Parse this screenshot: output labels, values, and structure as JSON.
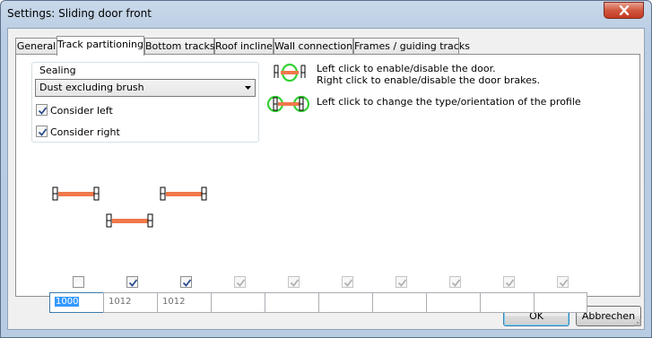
{
  "window": {
    "title": "Settings: Sliding door front"
  },
  "tabs": [
    {
      "label": "General"
    },
    {
      "label": "Track partitioning"
    },
    {
      "label": "Bottom tracks"
    },
    {
      "label": "Roof incline"
    },
    {
      "label": "Wall connection"
    },
    {
      "label": "Frames / guiding tracks"
    }
  ],
  "sealing": {
    "group_label": "Sealing",
    "selected": "Dust excluding brush",
    "consider_left": {
      "label": "Consider left",
      "checked": true
    },
    "consider_right": {
      "label": "Consider right",
      "checked": true
    }
  },
  "legend": {
    "line1": "Left click to enable/disable the door.",
    "line2": "Right click to enable/disable the door brakes.",
    "line3": "Left click to change the type/orientation of the profile"
  },
  "tracks": {
    "checkboxes": [
      {
        "checked": false,
        "enabled": true
      },
      {
        "checked": true,
        "enabled": true
      },
      {
        "checked": true,
        "enabled": true
      },
      {
        "checked": true,
        "enabled": false
      },
      {
        "checked": true,
        "enabled": false
      },
      {
        "checked": true,
        "enabled": false
      },
      {
        "checked": true,
        "enabled": false
      },
      {
        "checked": true,
        "enabled": false
      },
      {
        "checked": true,
        "enabled": false
      },
      {
        "checked": true,
        "enabled": false
      }
    ],
    "widths": [
      "1000",
      "1012",
      "1012",
      "",
      "",
      "",
      "",
      "",
      "",
      ""
    ]
  },
  "buttons": {
    "ok": "OK",
    "cancel": "Abbrechen"
  },
  "colors": {
    "door_bar": "#f0784a",
    "highlight_ring": "#35d135",
    "selection": "#3399ff"
  }
}
